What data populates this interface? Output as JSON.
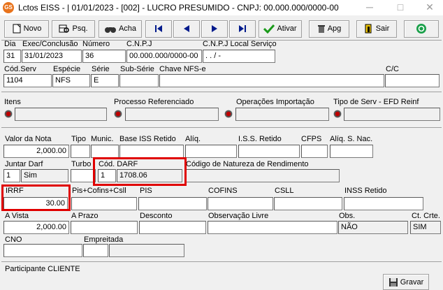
{
  "window": {
    "icon_text": "GS",
    "title": "Lctos EISS - | 01/01/2023 - [002] - LUCRO PRESUMIDO - CNPJ: 00.000.000/0000-00",
    "minimize": "─",
    "maximize": "□",
    "close": "✕"
  },
  "toolbar": {
    "novo": "Novo",
    "psq": "Psq.",
    "acha": "Acha",
    "ativar": "Ativar",
    "apg": "Apg",
    "sair": "Sair"
  },
  "labels": {
    "dia": "Dia",
    "exec": "Exec/Conclusão",
    "numero": "Número",
    "cnpj": "C.N.P.J",
    "cnpj_local": "C.N.P.J Local Serviço",
    "cod_serv": "Cód.Serv",
    "especie": "Espécie",
    "serie": "Série",
    "sub_serie": "Sub-Série",
    "chave": "Chave NFS-e",
    "cc": "C/C",
    "itens": "Itens",
    "processo": "Processo Referenciado",
    "operacoes": "Operações Importação",
    "tipo_serv": "Tipo de Serv - EFD Reinf",
    "valor_nota": "Valor da Nota",
    "tipo": "Tipo",
    "munic": "Munic.",
    "base_iss": "Base ISS Retido",
    "aliq": "Alíq.",
    "iss_retido": "I.S.S. Retido",
    "cfps": "CFPS",
    "aliq_snac": "Alíq. S. Nac.",
    "juntar_darf": "Juntar Darf",
    "turbo": "Turbo",
    "cod_darf": "Cód. DARF",
    "cod_natureza": "Código de Natureza de Rendimento",
    "irrf": "IRRF",
    "pis_cofins": "Pis+Cofins+Csll",
    "pis": "PIS",
    "cofins": "COFINS",
    "csll": "CSLL",
    "inss": "INSS Retido",
    "a_vista": "A Vista",
    "a_prazo": "A Prazo",
    "desconto": "Desconto",
    "obs_livre": "Observação Livre",
    "obs": "Obs.",
    "ct_crte": "Ct. Crte.",
    "cno": "CNO",
    "empreitada": "Empreitada"
  },
  "values": {
    "dia": "31",
    "exec": "31/01/2023",
    "numero": "36",
    "cnpj": "00.000.000/0000-00",
    "cnpj_local": ". . / -",
    "cod_serv": "1104",
    "especie": "NFS",
    "serie": "E",
    "valor_nota": "2,000.00",
    "juntar_darf_code": "1",
    "juntar_darf_text": "Sim",
    "cod_darf_code": "1",
    "cod_darf_value": "1708.06",
    "irrf": "30.00",
    "a_vista": "2,000.00",
    "obs": "NÃO",
    "ct_crte": "SIM"
  },
  "footer": {
    "participante": "Participante CLIENTE",
    "gravar": "Gravar"
  },
  "colors": {
    "highlight": "#e00000",
    "background": "#f0f0f0"
  }
}
